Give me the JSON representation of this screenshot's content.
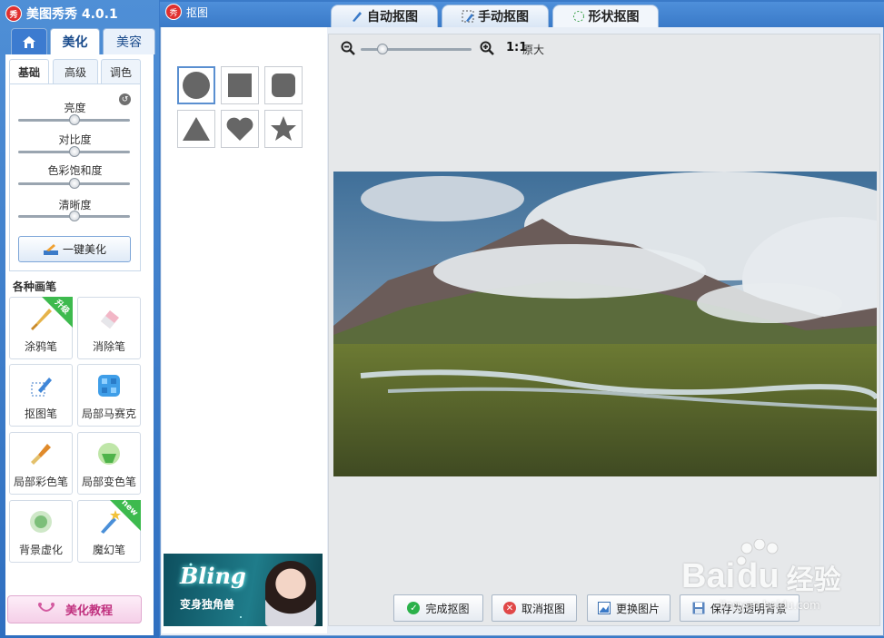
{
  "app": {
    "title": "美图秀秀 4.0.1",
    "logo_char": "秀"
  },
  "nav": {
    "home_icon": "home-icon",
    "beauty": "美化",
    "face": "美容"
  },
  "subtabs": {
    "basic": "基础",
    "advanced": "高级",
    "color": "调色"
  },
  "sliders": [
    {
      "label": "亮度",
      "level": 0.5
    },
    {
      "label": "对比度",
      "level": 0.5
    },
    {
      "label": "色彩饱和度",
      "level": 0.5
    },
    {
      "label": "清晰度",
      "level": 0.5
    }
  ],
  "one_click": "一键美化",
  "brushes": {
    "title": "各种画笔",
    "items": [
      {
        "label": "涂鸦笔",
        "badge": "升级"
      },
      {
        "label": "消除笔"
      },
      {
        "label": "抠图笔"
      },
      {
        "label": "局部马赛克"
      },
      {
        "label": "局部彩色笔"
      },
      {
        "label": "局部变色笔"
      },
      {
        "label": "背景虚化"
      },
      {
        "label": "魔幻笔",
        "badge": "new"
      }
    ]
  },
  "tutorial": "美化教程",
  "window": {
    "title": "抠图",
    "tabs": {
      "auto": "自动抠图",
      "manual": "手动抠图",
      "shape": "形状抠图"
    },
    "shapes": [
      "circle",
      "square",
      "rounded-square",
      "triangle",
      "heart",
      "star"
    ],
    "ad": {
      "headline": "Bling",
      "sub": "变身独角兽"
    },
    "zoom": {
      "ratio": "1:1",
      "original": "原大",
      "level": 0.2
    },
    "buttons": {
      "done": "完成抠图",
      "cancel": "取消抠图",
      "replace": "更换图片",
      "save": "保存为透明背景"
    }
  },
  "watermark": {
    "text": "Bai",
    "paw": "du",
    "cn": "经验",
    "url": "jingyan.baidu.com"
  },
  "colors": {
    "accent": "#3a7ac8",
    "done_green": "#2bb14a",
    "cancel_red": "#e04848",
    "ribbon_green": "#3dba4e"
  }
}
